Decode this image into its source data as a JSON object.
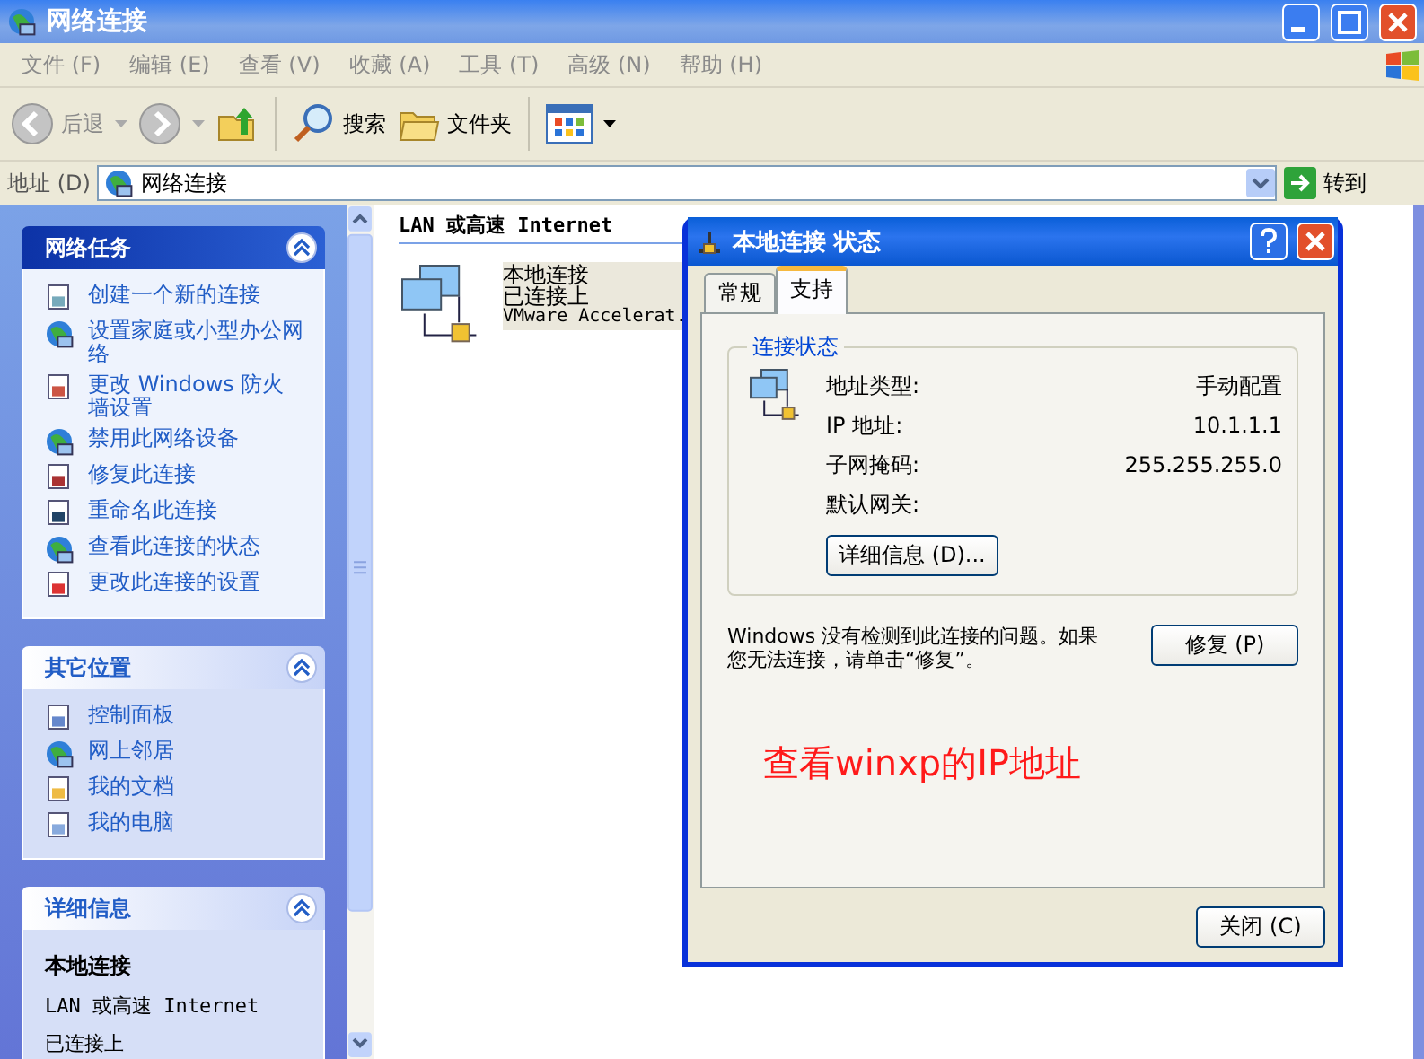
{
  "window": {
    "title": "网络连接"
  },
  "menu": [
    "文件 (F)",
    "编辑 (E)",
    "查看 (V)",
    "收藏 (A)",
    "工具 (T)",
    "高级 (N)",
    "帮助 (H)"
  ],
  "toolbar": {
    "back": "后退",
    "search": "搜索",
    "folders": "文件夹"
  },
  "address": {
    "label": "地址 (D)",
    "value": "网络连接",
    "go": "转到"
  },
  "sidebar": [
    {
      "kind": "special",
      "title": "网络任务",
      "expanded": true,
      "items": [
        "创建一个新的连接",
        "设置家庭或小型办公网络",
        "更改 Windows 防火墙设置",
        "禁用此网络设备",
        "修复此连接",
        "重命名此连接",
        "查看此连接的状态",
        "更改此连接的设置"
      ]
    },
    {
      "kind": "normal",
      "title": "其它位置",
      "expanded": true,
      "items": [
        "控制面板",
        "网上邻居",
        "我的文档",
        "我的电脑"
      ]
    },
    {
      "kind": "details",
      "title": "详细信息",
      "expanded": true,
      "heading": "本地连接",
      "lines": [
        "LAN 或高速 Internet",
        "已连接上"
      ]
    }
  ],
  "content": {
    "group": "LAN 或高速 Internet",
    "connection": {
      "name": "本地连接",
      "status": "已连接上",
      "device": "VMware Accelerat.",
      "selected": true
    }
  },
  "dialog": {
    "title": "本地连接 状态",
    "tabs": [
      {
        "label": "常规",
        "selected": false
      },
      {
        "label": "支持",
        "selected": true
      }
    ],
    "group": "连接状态",
    "rows": [
      {
        "label": "地址类型:",
        "value": "手动配置"
      },
      {
        "label": "IP 地址:",
        "value": "10.1.1.1"
      },
      {
        "label": "子网掩码:",
        "value": "255.255.255.0"
      },
      {
        "label": "默认网关:"
      }
    ],
    "details_button": "详细信息 (D)...",
    "message": "Windows 没有检测到此连接的问题。如果您无法连接，请单击“修复”。",
    "repair_button": "修复 (P)",
    "annotation": "查看winxp的IP地址",
    "close_button": "关闭 (C)"
  }
}
